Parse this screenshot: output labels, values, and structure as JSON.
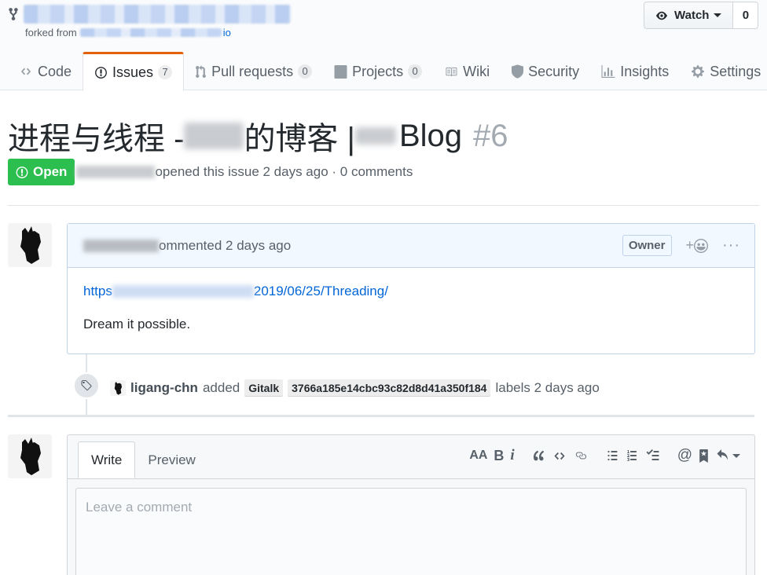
{
  "repo": {
    "forked_prefix": "forked from",
    "forked_suffix": "io",
    "watch_label": "Watch",
    "watch_count": "0"
  },
  "tabs": [
    {
      "label": "Code",
      "icon": "code-icon"
    },
    {
      "label": "Issues",
      "icon": "issue-opened-icon",
      "count": "7",
      "selected": true
    },
    {
      "label": "Pull requests",
      "icon": "git-pull-request-icon",
      "count": "0"
    },
    {
      "label": "Projects",
      "icon": "project-icon",
      "count": "0"
    },
    {
      "label": "Wiki",
      "icon": "book-icon"
    },
    {
      "label": "Security",
      "icon": "shield-icon"
    },
    {
      "label": "Insights",
      "icon": "graph-icon"
    },
    {
      "label": "Settings",
      "icon": "gear-icon"
    }
  ],
  "issue": {
    "title_part1": "进程与线程 - ",
    "title_part2": "的博客 | ",
    "title_part3": "Blog",
    "number": "#6",
    "state": "Open",
    "meta": "opened this issue 2 days ago · 0 comments"
  },
  "comment": {
    "header_text": "ommented 2 days ago",
    "badge": "Owner",
    "reaction": "+",
    "more": "···",
    "link_prefix": "https",
    "link_suffix": "2019/06/25/Threading/",
    "body": "Dream it possible."
  },
  "event": {
    "actor": "ligang-chn",
    "action": "added",
    "labels": [
      "Gitalk",
      "3766a185e14cbc93c82d8d41a350f184"
    ],
    "tail": "labels 2 days ago"
  },
  "editor": {
    "tab_write": "Write",
    "tab_preview": "Preview",
    "placeholder": "Leave a comment",
    "toolbar": {
      "header": "AA",
      "bold": "B",
      "italic": "i"
    }
  },
  "colors": {
    "open_green": "#2cbe4e",
    "selected_tab_accent": "#e36209",
    "link_blue": "#0366d6",
    "comment_header_bg": "#f1f8ff"
  }
}
